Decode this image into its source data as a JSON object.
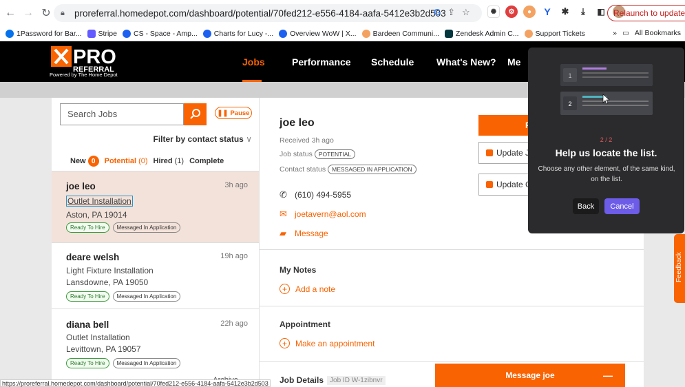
{
  "browser": {
    "url": "proreferral.homedepot.com/dashboard/potential/70fed212-e556-4184-aafa-5412e3b2d503",
    "relaunch_label": "Relaunch to update",
    "bookmarks": [
      {
        "label": "1Password for Bar...",
        "color": "#0572ec"
      },
      {
        "label": "Stripe",
        "color": "#635bff"
      },
      {
        "label": "CS - Space - Amp...",
        "color": "#1e61f0"
      },
      {
        "label": "Charts for Lucy -...",
        "color": "#1e61f0"
      },
      {
        "label": "Overview WoW | X...",
        "color": "#1e61f0"
      },
      {
        "label": "Bardeen Communi...",
        "color": "#f4a261"
      },
      {
        "label": "Zendesk Admin C...",
        "color": "#03363d"
      },
      {
        "label": "Support Tickets",
        "color": "#f4a261"
      }
    ],
    "bookmarks_overflow": "»",
    "all_bookmarks": "All Bookmarks",
    "status_url": "https://proreferral.homedepot.com/dashboard/potential/70fed212-e556-4184-aafa-5412e3b2d503"
  },
  "header": {
    "logo_text": "PRO",
    "logo_sub": "REFERRAL",
    "powered_by": "Powered by The Home Depot",
    "nav": [
      "Jobs",
      "Performance",
      "Schedule",
      "What's New?",
      "Me"
    ]
  },
  "list": {
    "search_placeholder": "Search Jobs",
    "pause_label": "Pause",
    "filter_label": "Filter by contact status",
    "tabs": [
      {
        "label": "New",
        "count": "0"
      },
      {
        "label": "Potential",
        "count": "(0)"
      },
      {
        "label": "Hired",
        "count": "(1)"
      },
      {
        "label": "Complete",
        "count": ""
      }
    ],
    "cards": [
      {
        "name": "joe leo",
        "time": "3h ago",
        "service": "Outlet Installation",
        "location": "Aston, PA 19014",
        "badges": [
          "Ready To Hire",
          "Messaged In Application"
        ]
      },
      {
        "name": "deare welsh",
        "time": "19h ago",
        "service": "Light Fixture Installation",
        "location": "Lansdowne, PA 19050",
        "badges": [
          "Ready To Hire",
          "Messaged In Application"
        ]
      },
      {
        "name": "diana bell",
        "time": "22h ago",
        "service": "Outlet Installation",
        "location": "Levittown, PA 19057",
        "badges": [
          "Ready To Hire",
          "Messaged In Application"
        ]
      }
    ],
    "archive_label": "Archive →"
  },
  "detail": {
    "name": "joe leo",
    "received": "Received 3h ago",
    "job_status_label": "Job status",
    "job_status": "POTENTIAL",
    "contact_status_label": "Contact status",
    "contact_status": "MESSAGED IN APPLICATION",
    "phone": "(610) 494-5955",
    "email": "joetavern@aol.com",
    "message_link": "Message",
    "primary_btn_letter": "F",
    "update_job_label": "Update J",
    "update_contact_label": "Update C",
    "notes_heading": "My Notes",
    "add_note": "Add a note",
    "appointment_heading": "Appointment",
    "make_appointment": "Make an appointment",
    "job_details_heading": "Job Details",
    "job_id": "Job ID W-1zibnvr",
    "message_bar": "Message joe",
    "feedback": "Feedback"
  },
  "popover": {
    "step": "2 / 2",
    "title": "Help us locate the list.",
    "description": "Choose any other element, of the same kind, on the list.",
    "back_label": "Back",
    "cancel_label": "Cancel",
    "illus_row1": "1",
    "illus_row2": "2"
  },
  "colors": {
    "brand_orange": "#f96302",
    "popover_bg": "#2b2b2d",
    "popover_accent": "#6c5ce7"
  }
}
